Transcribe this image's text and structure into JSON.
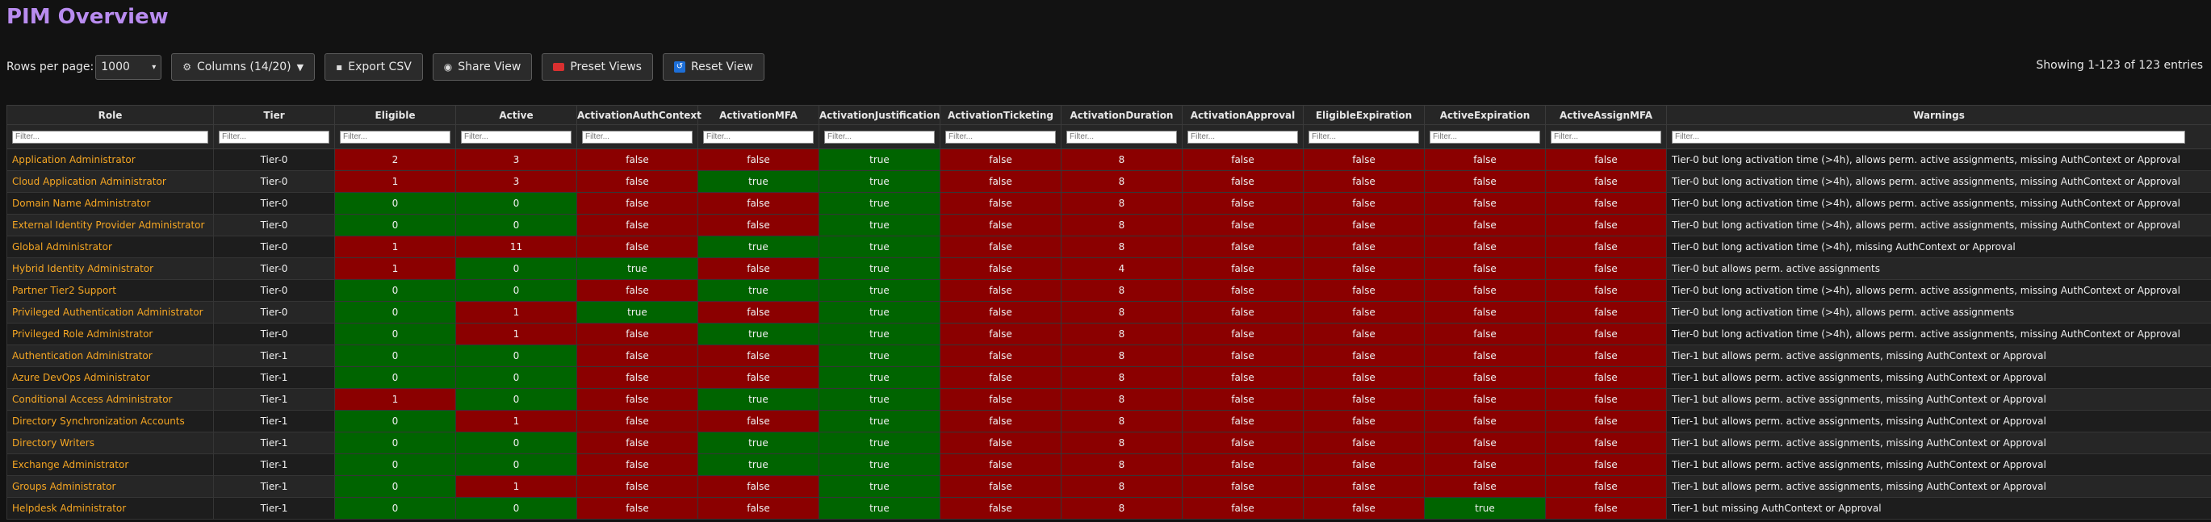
{
  "title": "PIM Overview",
  "toolbar": {
    "rows_label": "Rows per page:",
    "rows_value": "1000",
    "columns_label": "Columns (14/20)",
    "export_label": "Export CSV",
    "share_label": "Share View",
    "preset_label": "Preset Views",
    "reset_label": "Reset View"
  },
  "entries_info": "Showing 1-123 of 123 entries",
  "filter_placeholder": "Filter...",
  "columns": [
    "Role",
    "Tier",
    "Eligible",
    "Active",
    "ActivationAuthContext",
    "ActivationMFA",
    "ActivationJustification",
    "ActivationTicketing",
    "ActivationDuration",
    "ActivationApproval",
    "EligibleExpiration",
    "ActiveExpiration",
    "ActiveAssignMFA",
    "Warnings"
  ],
  "colors": {
    "bad": "#8b0000",
    "good": "#006400",
    "role_link": "#f5a623",
    "title": "#b98cf0"
  },
  "rows": [
    [
      "Application Administrator",
      "Tier-0",
      "2",
      "3",
      "false",
      "false",
      "true",
      "false",
      "8",
      "false",
      "false",
      "false",
      "false",
      "Tier-0 but long activation time (>4h), allows perm. active assignments, missing AuthContext or Approval"
    ],
    [
      "Cloud Application Administrator",
      "Tier-0",
      "1",
      "3",
      "false",
      "true",
      "true",
      "false",
      "8",
      "false",
      "false",
      "false",
      "false",
      "Tier-0 but long activation time (>4h), allows perm. active assignments, missing AuthContext or Approval"
    ],
    [
      "Domain Name Administrator",
      "Tier-0",
      "0",
      "0",
      "false",
      "false",
      "true",
      "false",
      "8",
      "false",
      "false",
      "false",
      "false",
      "Tier-0 but long activation time (>4h), allows perm. active assignments, missing AuthContext or Approval"
    ],
    [
      "External Identity Provider Administrator",
      "Tier-0",
      "0",
      "0",
      "false",
      "false",
      "true",
      "false",
      "8",
      "false",
      "false",
      "false",
      "false",
      "Tier-0 but long activation time (>4h), allows perm. active assignments, missing AuthContext or Approval"
    ],
    [
      "Global Administrator",
      "Tier-0",
      "1",
      "11",
      "false",
      "true",
      "true",
      "false",
      "8",
      "false",
      "false",
      "false",
      "false",
      "Tier-0 but long activation time (>4h), missing AuthContext or Approval"
    ],
    [
      "Hybrid Identity Administrator",
      "Tier-0",
      "1",
      "0",
      "true",
      "false",
      "true",
      "false",
      "4",
      "false",
      "false",
      "false",
      "false",
      "Tier-0 but allows perm. active assignments"
    ],
    [
      "Partner Tier2 Support",
      "Tier-0",
      "0",
      "0",
      "false",
      "true",
      "true",
      "false",
      "8",
      "false",
      "false",
      "false",
      "false",
      "Tier-0 but long activation time (>4h), allows perm. active assignments, missing AuthContext or Approval"
    ],
    [
      "Privileged Authentication Administrator",
      "Tier-0",
      "0",
      "1",
      "true",
      "false",
      "true",
      "false",
      "8",
      "false",
      "false",
      "false",
      "false",
      "Tier-0 but long activation time (>4h), allows perm. active assignments"
    ],
    [
      "Privileged Role Administrator",
      "Tier-0",
      "0",
      "1",
      "false",
      "true",
      "true",
      "false",
      "8",
      "false",
      "false",
      "false",
      "false",
      "Tier-0 but long activation time (>4h), allows perm. active assignments, missing AuthContext or Approval"
    ],
    [
      "Authentication Administrator",
      "Tier-1",
      "0",
      "0",
      "false",
      "false",
      "true",
      "false",
      "8",
      "false",
      "false",
      "false",
      "false",
      "Tier-1 but allows perm. active assignments, missing AuthContext or Approval"
    ],
    [
      "Azure DevOps Administrator",
      "Tier-1",
      "0",
      "0",
      "false",
      "false",
      "true",
      "false",
      "8",
      "false",
      "false",
      "false",
      "false",
      "Tier-1 but allows perm. active assignments, missing AuthContext or Approval"
    ],
    [
      "Conditional Access Administrator",
      "Tier-1",
      "1",
      "0",
      "false",
      "true",
      "true",
      "false",
      "8",
      "false",
      "false",
      "false",
      "false",
      "Tier-1 but allows perm. active assignments, missing AuthContext or Approval"
    ],
    [
      "Directory Synchronization Accounts",
      "Tier-1",
      "0",
      "1",
      "false",
      "false",
      "true",
      "false",
      "8",
      "false",
      "false",
      "false",
      "false",
      "Tier-1 but allows perm. active assignments, missing AuthContext or Approval"
    ],
    [
      "Directory Writers",
      "Tier-1",
      "0",
      "0",
      "false",
      "true",
      "true",
      "false",
      "8",
      "false",
      "false",
      "false",
      "false",
      "Tier-1 but allows perm. active assignments, missing AuthContext or Approval"
    ],
    [
      "Exchange Administrator",
      "Tier-1",
      "0",
      "0",
      "false",
      "true",
      "true",
      "false",
      "8",
      "false",
      "false",
      "false",
      "false",
      "Tier-1 but allows perm. active assignments, missing AuthContext or Approval"
    ],
    [
      "Groups Administrator",
      "Tier-1",
      "0",
      "1",
      "false",
      "false",
      "true",
      "false",
      "8",
      "false",
      "false",
      "false",
      "false",
      "Tier-1 but allows perm. active assignments, missing AuthContext or Approval"
    ],
    [
      "Helpdesk Administrator",
      "Tier-1",
      "0",
      "0",
      "false",
      "false",
      "true",
      "false",
      "8",
      "false",
      "false",
      "true",
      "false",
      "Tier-1 but missing AuthContext or Approval"
    ]
  ],
  "cell_status": [
    [
      "plain",
      "plain",
      "bad",
      "bad",
      "bad",
      "bad",
      "good",
      "bad",
      "bad",
      "bad",
      "bad",
      "bad",
      "bad",
      "plain"
    ],
    [
      "plain",
      "plain",
      "bad",
      "bad",
      "bad",
      "good",
      "good",
      "bad",
      "bad",
      "bad",
      "bad",
      "bad",
      "bad",
      "plain"
    ],
    [
      "plain",
      "plain",
      "good",
      "good",
      "bad",
      "bad",
      "good",
      "bad",
      "bad",
      "bad",
      "bad",
      "bad",
      "bad",
      "plain"
    ],
    [
      "plain",
      "plain",
      "good",
      "good",
      "bad",
      "bad",
      "good",
      "bad",
      "bad",
      "bad",
      "bad",
      "bad",
      "bad",
      "plain"
    ],
    [
      "plain",
      "plain",
      "bad",
      "bad",
      "bad",
      "good",
      "good",
      "bad",
      "bad",
      "bad",
      "bad",
      "bad",
      "bad",
      "plain"
    ],
    [
      "plain",
      "plain",
      "bad",
      "good",
      "good",
      "bad",
      "good",
      "bad",
      "bad",
      "bad",
      "bad",
      "bad",
      "bad",
      "plain"
    ],
    [
      "plain",
      "plain",
      "good",
      "good",
      "bad",
      "good",
      "good",
      "bad",
      "bad",
      "bad",
      "bad",
      "bad",
      "bad",
      "plain"
    ],
    [
      "plain",
      "plain",
      "good",
      "bad",
      "good",
      "bad",
      "good",
      "bad",
      "bad",
      "bad",
      "bad",
      "bad",
      "bad",
      "plain"
    ],
    [
      "plain",
      "plain",
      "good",
      "bad",
      "bad",
      "good",
      "good",
      "bad",
      "bad",
      "bad",
      "bad",
      "bad",
      "bad",
      "plain"
    ],
    [
      "plain",
      "plain",
      "good",
      "good",
      "bad",
      "bad",
      "good",
      "bad",
      "bad",
      "bad",
      "bad",
      "bad",
      "bad",
      "plain"
    ],
    [
      "plain",
      "plain",
      "good",
      "good",
      "bad",
      "bad",
      "good",
      "bad",
      "bad",
      "bad",
      "bad",
      "bad",
      "bad",
      "plain"
    ],
    [
      "plain",
      "plain",
      "bad",
      "good",
      "bad",
      "good",
      "good",
      "bad",
      "bad",
      "bad",
      "bad",
      "bad",
      "bad",
      "plain"
    ],
    [
      "plain",
      "plain",
      "good",
      "bad",
      "bad",
      "bad",
      "good",
      "bad",
      "bad",
      "bad",
      "bad",
      "bad",
      "bad",
      "plain"
    ],
    [
      "plain",
      "plain",
      "good",
      "good",
      "bad",
      "good",
      "good",
      "bad",
      "bad",
      "bad",
      "bad",
      "bad",
      "bad",
      "plain"
    ],
    [
      "plain",
      "plain",
      "good",
      "good",
      "bad",
      "good",
      "good",
      "bad",
      "bad",
      "bad",
      "bad",
      "bad",
      "bad",
      "plain"
    ],
    [
      "plain",
      "plain",
      "good",
      "bad",
      "bad",
      "bad",
      "good",
      "bad",
      "bad",
      "bad",
      "bad",
      "bad",
      "bad",
      "plain"
    ],
    [
      "plain",
      "plain",
      "good",
      "good",
      "bad",
      "bad",
      "good",
      "bad",
      "bad",
      "bad",
      "bad",
      "good",
      "bad",
      "plain"
    ]
  ]
}
